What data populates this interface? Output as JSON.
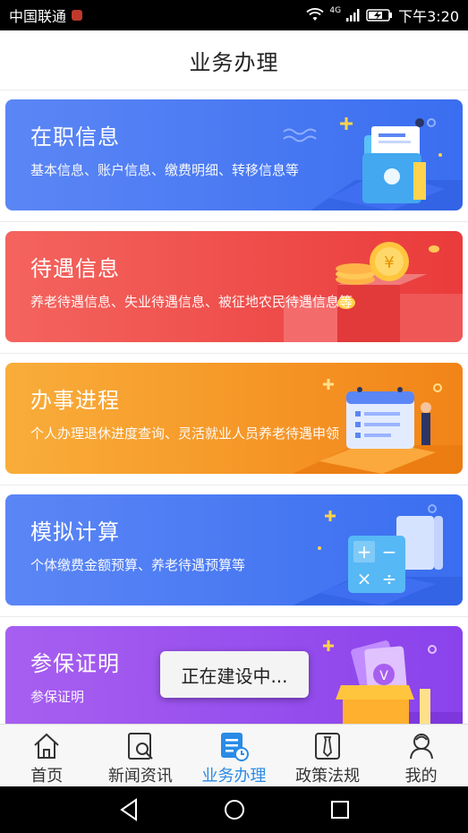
{
  "status_bar": {
    "carrier": "中国联通",
    "network_label": "4G",
    "time": "下午3:20"
  },
  "header": {
    "title": "业务办理"
  },
  "cards": [
    {
      "title": "在职信息",
      "desc": "基本信息、账户信息、缴费明细、转移信息等",
      "color": "#4a7bf3",
      "icon": "folder-document-illustration"
    },
    {
      "title": "待遇信息",
      "desc": "养老待遇信息、失业待遇信息、被征地农民待遇信息等",
      "color": "#ef4d4b",
      "icon": "gold-coin-illustration"
    },
    {
      "title": "办事进程",
      "desc": "个人办理退休进度查询、灵活就业人员养老待遇申领",
      "color": "#f59a28",
      "icon": "calendar-checklist-illustration"
    },
    {
      "title": "模拟计算",
      "desc": "个体缴费金额预算、养老待遇预算等",
      "color": "#4a7bf3",
      "icon": "calculator-illustration"
    },
    {
      "title": "参保证明",
      "desc": "参保证明",
      "color": "#9a50ee",
      "icon": "gift-box-illustration"
    }
  ],
  "toast": {
    "text": "正在建设中..."
  },
  "bottom_nav": {
    "active_color": "#2a8be6",
    "items": [
      {
        "label": "首页",
        "icon": "home-icon"
      },
      {
        "label": "新闻资讯",
        "icon": "news-search-icon"
      },
      {
        "label": "业务办理",
        "icon": "business-document-icon",
        "active": true
      },
      {
        "label": "政策法规",
        "icon": "policy-tie-icon"
      },
      {
        "label": "我的",
        "icon": "profile-icon"
      }
    ]
  }
}
